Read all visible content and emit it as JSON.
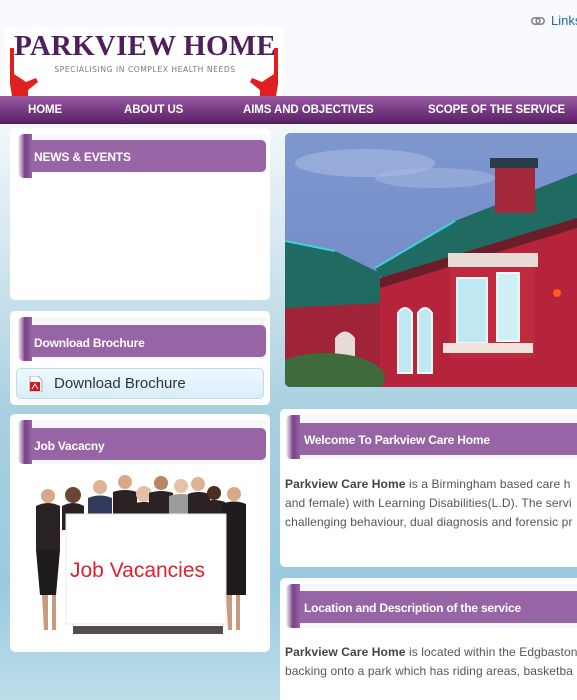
{
  "header": {
    "logo_title": "PARKVIEW HOME",
    "logo_tagline": "SPECIALISING IN COMPLEX HEALTH NEEDS",
    "top_link": {
      "label": "Links",
      "icon": "link-icon"
    }
  },
  "nav": {
    "items": [
      {
        "label": "HOME"
      },
      {
        "label": "ABOUT US"
      },
      {
        "label": "AIMS AND OBJECTIVES"
      },
      {
        "label": "SCOPE OF THE SERVICE"
      }
    ]
  },
  "sidebar": {
    "news": {
      "title": "NEWS & EVENTS"
    },
    "brochure": {
      "title": "Download Brochure",
      "button_label": "Download Brochure",
      "button_icon": "pdf-icon"
    },
    "jobs": {
      "title": "Job Vacacny",
      "image_text": "Job Vacancies"
    }
  },
  "main": {
    "hero_alt": "Parkview Care Home building",
    "welcome": {
      "title": "Welcome To Parkview Care Home",
      "bold_lead": "Parkview Care Home",
      "line1_rest": " is a Birmingham based care h",
      "line2": "and female) with Learning Disabilities(L.D). The servi",
      "line3": "challenging behaviour, dual diagnosis and forensic pr"
    },
    "location": {
      "title": "Location and Description of the service",
      "bold_lead": "Parkview Care Home",
      "line1_rest": " is located within the Edgbaston",
      "line2": "backing onto a park which has riding areas, basketba"
    }
  },
  "colors": {
    "brand_purple": "#9765a5",
    "nav_purple": "#7b3f88",
    "logo_text": "#4e1f5a",
    "accent_red": "#e0202a",
    "link_blue": "#1b6d9e"
  }
}
